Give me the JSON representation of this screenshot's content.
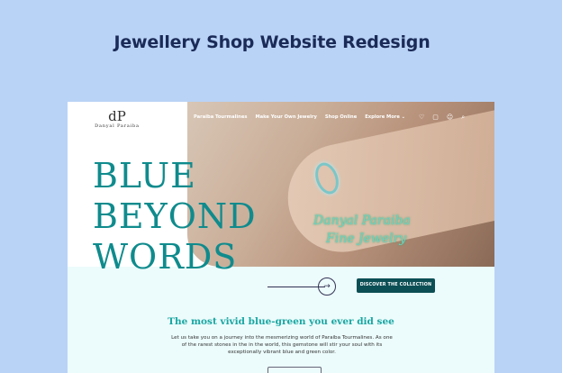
{
  "page": {
    "headline": "Jewellery Shop  Website Redesign"
  },
  "site": {
    "logo_mark": "dP",
    "logo_text": "Danyal Paraiba",
    "nav": [
      "Paraiba Tourmalines",
      "Make Your Own Jewelry",
      "Shop Online",
      "Explore More ⌄"
    ],
    "icons": [
      "heart-icon",
      "bag-icon",
      "user-icon",
      "search-icon"
    ],
    "icon_glyphs": [
      "♡",
      "▢",
      "☺",
      "⌕"
    ],
    "hero_title": [
      "BLUE",
      "BEYOND",
      "WORDS"
    ],
    "photo_brand": [
      "Danyal Paraiba",
      "Fine Jewelry"
    ],
    "cta_label": "DISCOVER THE COLLECTION",
    "tagline": "The most vivid blue-green you ever did see",
    "body_copy": "Let us take you on a journey into the mesmerizing world of Paraiba Tourmalines. As one of the rarest stones in the in the world, this gemstone will stir your soul with its exceptionally vibrant blue and green color.",
    "colors": {
      "accent": "#0f8b8d",
      "button": "#0c4f55",
      "background": "#b9d3f6"
    }
  }
}
